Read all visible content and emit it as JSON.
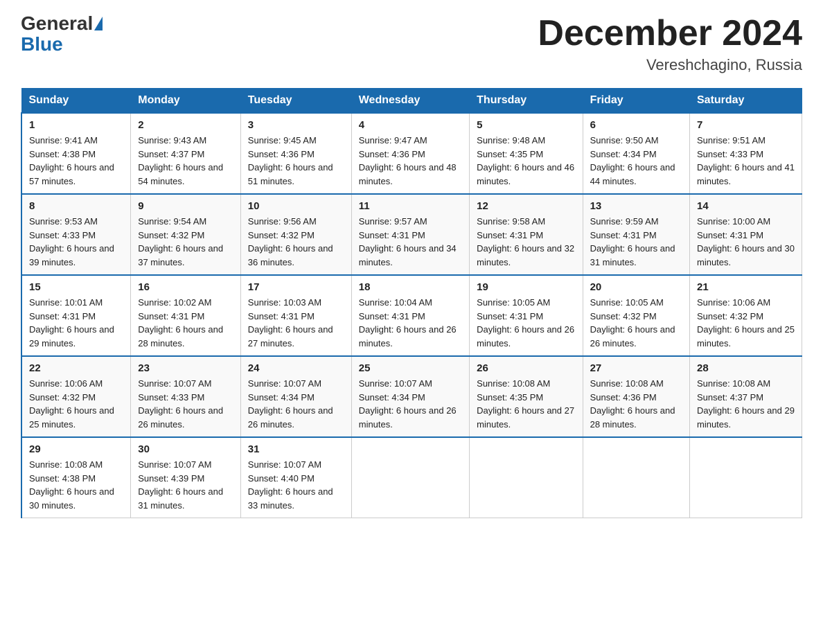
{
  "logo": {
    "general": "General",
    "blue": "Blue"
  },
  "title": "December 2024",
  "subtitle": "Vereshchagino, Russia",
  "days_of_week": [
    "Sunday",
    "Monday",
    "Tuesday",
    "Wednesday",
    "Thursday",
    "Friday",
    "Saturday"
  ],
  "weeks": [
    [
      {
        "num": "1",
        "sunrise": "Sunrise: 9:41 AM",
        "sunset": "Sunset: 4:38 PM",
        "daylight": "Daylight: 6 hours and 57 minutes."
      },
      {
        "num": "2",
        "sunrise": "Sunrise: 9:43 AM",
        "sunset": "Sunset: 4:37 PM",
        "daylight": "Daylight: 6 hours and 54 minutes."
      },
      {
        "num": "3",
        "sunrise": "Sunrise: 9:45 AM",
        "sunset": "Sunset: 4:36 PM",
        "daylight": "Daylight: 6 hours and 51 minutes."
      },
      {
        "num": "4",
        "sunrise": "Sunrise: 9:47 AM",
        "sunset": "Sunset: 4:36 PM",
        "daylight": "Daylight: 6 hours and 48 minutes."
      },
      {
        "num": "5",
        "sunrise": "Sunrise: 9:48 AM",
        "sunset": "Sunset: 4:35 PM",
        "daylight": "Daylight: 6 hours and 46 minutes."
      },
      {
        "num": "6",
        "sunrise": "Sunrise: 9:50 AM",
        "sunset": "Sunset: 4:34 PM",
        "daylight": "Daylight: 6 hours and 44 minutes."
      },
      {
        "num": "7",
        "sunrise": "Sunrise: 9:51 AM",
        "sunset": "Sunset: 4:33 PM",
        "daylight": "Daylight: 6 hours and 41 minutes."
      }
    ],
    [
      {
        "num": "8",
        "sunrise": "Sunrise: 9:53 AM",
        "sunset": "Sunset: 4:33 PM",
        "daylight": "Daylight: 6 hours and 39 minutes."
      },
      {
        "num": "9",
        "sunrise": "Sunrise: 9:54 AM",
        "sunset": "Sunset: 4:32 PM",
        "daylight": "Daylight: 6 hours and 37 minutes."
      },
      {
        "num": "10",
        "sunrise": "Sunrise: 9:56 AM",
        "sunset": "Sunset: 4:32 PM",
        "daylight": "Daylight: 6 hours and 36 minutes."
      },
      {
        "num": "11",
        "sunrise": "Sunrise: 9:57 AM",
        "sunset": "Sunset: 4:31 PM",
        "daylight": "Daylight: 6 hours and 34 minutes."
      },
      {
        "num": "12",
        "sunrise": "Sunrise: 9:58 AM",
        "sunset": "Sunset: 4:31 PM",
        "daylight": "Daylight: 6 hours and 32 minutes."
      },
      {
        "num": "13",
        "sunrise": "Sunrise: 9:59 AM",
        "sunset": "Sunset: 4:31 PM",
        "daylight": "Daylight: 6 hours and 31 minutes."
      },
      {
        "num": "14",
        "sunrise": "Sunrise: 10:00 AM",
        "sunset": "Sunset: 4:31 PM",
        "daylight": "Daylight: 6 hours and 30 minutes."
      }
    ],
    [
      {
        "num": "15",
        "sunrise": "Sunrise: 10:01 AM",
        "sunset": "Sunset: 4:31 PM",
        "daylight": "Daylight: 6 hours and 29 minutes."
      },
      {
        "num": "16",
        "sunrise": "Sunrise: 10:02 AM",
        "sunset": "Sunset: 4:31 PM",
        "daylight": "Daylight: 6 hours and 28 minutes."
      },
      {
        "num": "17",
        "sunrise": "Sunrise: 10:03 AM",
        "sunset": "Sunset: 4:31 PM",
        "daylight": "Daylight: 6 hours and 27 minutes."
      },
      {
        "num": "18",
        "sunrise": "Sunrise: 10:04 AM",
        "sunset": "Sunset: 4:31 PM",
        "daylight": "Daylight: 6 hours and 26 minutes."
      },
      {
        "num": "19",
        "sunrise": "Sunrise: 10:05 AM",
        "sunset": "Sunset: 4:31 PM",
        "daylight": "Daylight: 6 hours and 26 minutes."
      },
      {
        "num": "20",
        "sunrise": "Sunrise: 10:05 AM",
        "sunset": "Sunset: 4:32 PM",
        "daylight": "Daylight: 6 hours and 26 minutes."
      },
      {
        "num": "21",
        "sunrise": "Sunrise: 10:06 AM",
        "sunset": "Sunset: 4:32 PM",
        "daylight": "Daylight: 6 hours and 25 minutes."
      }
    ],
    [
      {
        "num": "22",
        "sunrise": "Sunrise: 10:06 AM",
        "sunset": "Sunset: 4:32 PM",
        "daylight": "Daylight: 6 hours and 25 minutes."
      },
      {
        "num": "23",
        "sunrise": "Sunrise: 10:07 AM",
        "sunset": "Sunset: 4:33 PM",
        "daylight": "Daylight: 6 hours and 26 minutes."
      },
      {
        "num": "24",
        "sunrise": "Sunrise: 10:07 AM",
        "sunset": "Sunset: 4:34 PM",
        "daylight": "Daylight: 6 hours and 26 minutes."
      },
      {
        "num": "25",
        "sunrise": "Sunrise: 10:07 AM",
        "sunset": "Sunset: 4:34 PM",
        "daylight": "Daylight: 6 hours and 26 minutes."
      },
      {
        "num": "26",
        "sunrise": "Sunrise: 10:08 AM",
        "sunset": "Sunset: 4:35 PM",
        "daylight": "Daylight: 6 hours and 27 minutes."
      },
      {
        "num": "27",
        "sunrise": "Sunrise: 10:08 AM",
        "sunset": "Sunset: 4:36 PM",
        "daylight": "Daylight: 6 hours and 28 minutes."
      },
      {
        "num": "28",
        "sunrise": "Sunrise: 10:08 AM",
        "sunset": "Sunset: 4:37 PM",
        "daylight": "Daylight: 6 hours and 29 minutes."
      }
    ],
    [
      {
        "num": "29",
        "sunrise": "Sunrise: 10:08 AM",
        "sunset": "Sunset: 4:38 PM",
        "daylight": "Daylight: 6 hours and 30 minutes."
      },
      {
        "num": "30",
        "sunrise": "Sunrise: 10:07 AM",
        "sunset": "Sunset: 4:39 PM",
        "daylight": "Daylight: 6 hours and 31 minutes."
      },
      {
        "num": "31",
        "sunrise": "Sunrise: 10:07 AM",
        "sunset": "Sunset: 4:40 PM",
        "daylight": "Daylight: 6 hours and 33 minutes."
      },
      {
        "num": "",
        "sunrise": "",
        "sunset": "",
        "daylight": ""
      },
      {
        "num": "",
        "sunrise": "",
        "sunset": "",
        "daylight": ""
      },
      {
        "num": "",
        "sunrise": "",
        "sunset": "",
        "daylight": ""
      },
      {
        "num": "",
        "sunrise": "",
        "sunset": "",
        "daylight": ""
      }
    ]
  ]
}
